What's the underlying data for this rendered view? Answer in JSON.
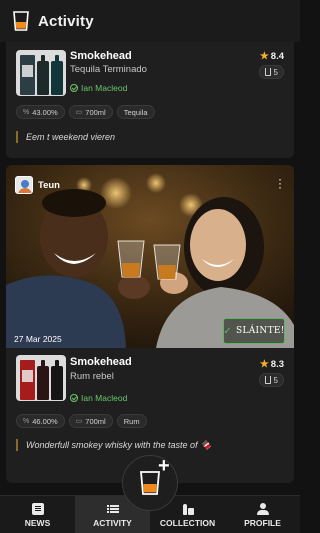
{
  "header": {
    "title": "Activity",
    "logo_icon": "whisky-glass-logo-icon"
  },
  "posts": [
    {
      "name": "Smokehead",
      "subtitle": "Tequila Terminado",
      "member": "Ian Macleod",
      "rating": "8.4",
      "count": "5",
      "tags": [
        {
          "icon": "percent-icon",
          "label": "43.00%"
        },
        {
          "icon": "bottle-size-icon",
          "label": "700ml"
        },
        {
          "label": "Tequila"
        }
      ],
      "comment": "Eem t weekend vieren"
    },
    {
      "user": "Teun",
      "date": "27 Mar 2025",
      "reaction": "SLÁINTE!",
      "name": "Smokehead",
      "subtitle": "Rum rebel",
      "member": "Ian Macleod",
      "rating": "8.3",
      "count": "5",
      "tags": [
        {
          "icon": "percent-icon",
          "label": "46.00%"
        },
        {
          "icon": "bottle-size-icon",
          "label": "700ml"
        },
        {
          "label": "Rum"
        }
      ],
      "comment": "Wonderfull smokey whisky with the taste of 🍫"
    }
  ],
  "nav": {
    "items": [
      {
        "label": "NEWS",
        "icon": "news-icon"
      },
      {
        "label": "ACTIVITY",
        "icon": "list-icon"
      },
      {
        "label": "COLLECTION",
        "icon": "collection-icon"
      },
      {
        "label": "PROFILE",
        "icon": "profile-icon"
      }
    ],
    "active": "ACTIVITY",
    "fab": "add-dram-button"
  },
  "colors": {
    "background": "#121212",
    "card": "#1f1f1f",
    "accent_orange": "#f08a1c",
    "star": "#f3b22a",
    "member_green": "#6dc56d"
  }
}
